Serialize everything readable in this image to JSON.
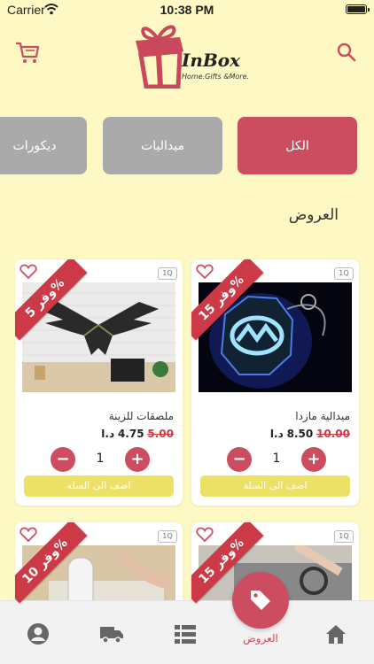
{
  "status_bar": {
    "carrier": "Carrier",
    "time": "10:38 PM"
  },
  "header": {
    "logo_name": "InBox",
    "logo_tagline": "Home.Gifts &More.",
    "cart_icon": "cart-icon",
    "search_icon": "search-icon"
  },
  "categories": [
    {
      "label": "الكل",
      "active": true
    },
    {
      "label": "ميداليات",
      "active": false
    },
    {
      "label": "ديكورات",
      "active": false
    }
  ],
  "section_title": "العروض",
  "products": [
    {
      "name": "ميدالية مازدا",
      "old_price": "10.00",
      "new_price": "8.50",
      "currency": "د.ا",
      "quantity": "1",
      "discount": "وفر 15%",
      "badge": "1Q",
      "add_label": "اضف الى السلة"
    },
    {
      "name": "ملصقات للزينة",
      "old_price": "5.00",
      "new_price": "4.75",
      "currency": "د.ا",
      "quantity": "1",
      "discount": "وفر 5%",
      "badge": "1Q",
      "add_label": "اضف الى السلة"
    },
    {
      "name": "",
      "discount": "وفر 15%",
      "badge": "1Q"
    },
    {
      "name": "",
      "discount": "وفر 10%",
      "badge": "1Q"
    }
  ],
  "tab_bar": {
    "items": [
      {
        "icon": "home-icon"
      },
      {
        "icon": "offers-tag-icon",
        "label": "العروض",
        "active": true
      },
      {
        "icon": "list-icon"
      },
      {
        "icon": "truck-icon"
      },
      {
        "icon": "profile-icon"
      }
    ]
  },
  "colors": {
    "background": "#fdf8c4",
    "accent": "#cc4d60",
    "inactive_tab": "#aaaaaa",
    "add_button": "#ece066"
  }
}
